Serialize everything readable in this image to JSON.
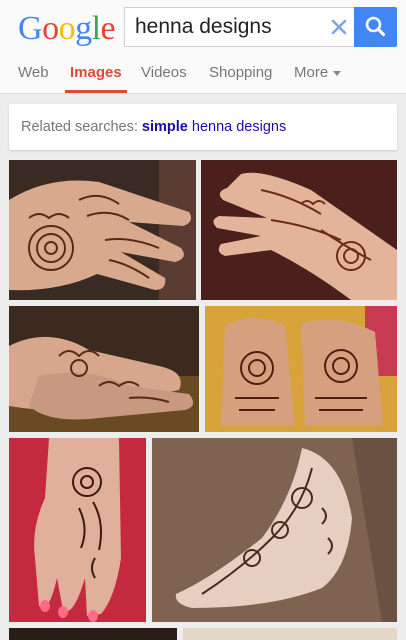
{
  "logo": {
    "letters": [
      "G",
      "o",
      "o",
      "g",
      "l",
      "e"
    ]
  },
  "search": {
    "query": "henna designs"
  },
  "tabs": [
    {
      "label": "Web"
    },
    {
      "label": "Images"
    },
    {
      "label": "Videos"
    },
    {
      "label": "Shopping"
    },
    {
      "label": "More"
    }
  ],
  "active_tab": "Images",
  "related": {
    "label": "Related searches:",
    "suggestion_bold": "simple",
    "suggestion_rest": "henna designs"
  },
  "results": [
    {
      "alt": "henna on palm"
    },
    {
      "alt": "henna on back of hand"
    },
    {
      "alt": "henna on feet"
    },
    {
      "alt": "henna on both palms"
    },
    {
      "alt": "henna on hand with pink nails"
    },
    {
      "alt": "henna on foot"
    },
    {
      "alt": "more result"
    },
    {
      "alt": "more result"
    }
  ],
  "colors": {
    "accent": "#dd4b39",
    "search_button": "#4285f4",
    "link": "#1a0dab",
    "logo": [
      "#4285f4",
      "#ea4335",
      "#fbbc05",
      "#4285f4",
      "#34a853",
      "#ea4335"
    ]
  }
}
